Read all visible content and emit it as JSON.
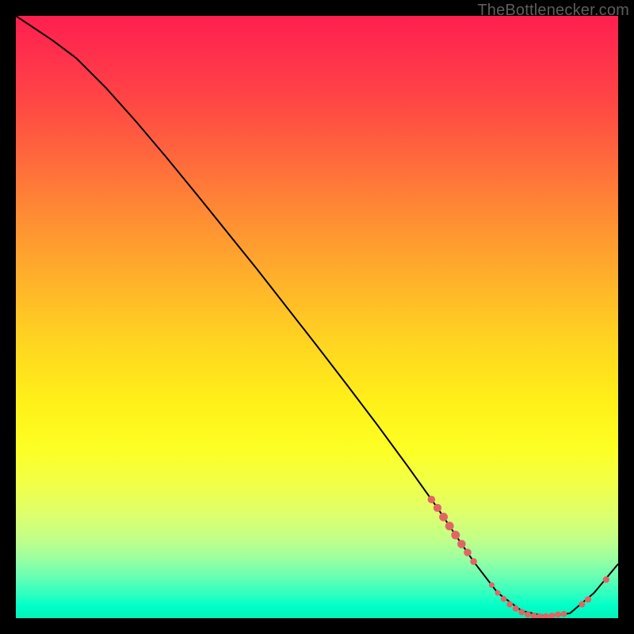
{
  "watermark": "TheBottlenecker.com",
  "chart_data": {
    "type": "line",
    "title": "",
    "xlabel": "",
    "ylabel": "",
    "xlim": [
      0,
      100
    ],
    "ylim": [
      0,
      100
    ],
    "series": [
      {
        "name": "curve",
        "x": [
          0,
          6,
          10,
          15,
          20,
          25,
          30,
          35,
          40,
          45,
          50,
          55,
          60,
          65,
          70,
          73,
          76,
          80,
          84,
          88,
          92,
          96,
          100
        ],
        "y": [
          100,
          96,
          93,
          88,
          82.4,
          76.5,
          70.4,
          64.2,
          58,
          51.6,
          45.2,
          38.7,
          32.1,
          25.3,
          18.3,
          13.8,
          9.4,
          4.2,
          1.2,
          0.3,
          0.8,
          4.2,
          9.0
        ]
      }
    ],
    "markers": [
      {
        "x": 69,
        "y": 19.7,
        "r": 3.0
      },
      {
        "x": 70,
        "y": 18.3,
        "r": 3.2
      },
      {
        "x": 71,
        "y": 16.8,
        "r": 3.4
      },
      {
        "x": 72,
        "y": 15.3,
        "r": 3.4
      },
      {
        "x": 73,
        "y": 13.8,
        "r": 3.4
      },
      {
        "x": 74,
        "y": 12.3,
        "r": 3.3
      },
      {
        "x": 75,
        "y": 10.9,
        "r": 3.0
      },
      {
        "x": 76,
        "y": 9.4,
        "r": 2.7
      },
      {
        "x": 79,
        "y": 5.5,
        "r": 2.2
      },
      {
        "x": 80,
        "y": 4.2,
        "r": 2.2
      },
      {
        "x": 81,
        "y": 3.2,
        "r": 2.4
      },
      {
        "x": 82,
        "y": 2.3,
        "r": 2.5
      },
      {
        "x": 83,
        "y": 1.6,
        "r": 2.5
      },
      {
        "x": 84,
        "y": 1.0,
        "r": 2.5
      },
      {
        "x": 85,
        "y": 0.6,
        "r": 2.5
      },
      {
        "x": 86,
        "y": 0.4,
        "r": 2.5
      },
      {
        "x": 87,
        "y": 0.3,
        "r": 2.5
      },
      {
        "x": 88,
        "y": 0.3,
        "r": 2.5
      },
      {
        "x": 89,
        "y": 0.4,
        "r": 2.5
      },
      {
        "x": 90,
        "y": 0.6,
        "r": 2.5
      },
      {
        "x": 91,
        "y": 0.7,
        "r": 2.4
      },
      {
        "x": 94,
        "y": 2.3,
        "r": 2.5
      },
      {
        "x": 95,
        "y": 3.1,
        "r": 2.6
      },
      {
        "x": 98,
        "y": 6.4,
        "r": 2.6
      }
    ],
    "marker_color": "#e06666",
    "line_color": "#000000"
  }
}
